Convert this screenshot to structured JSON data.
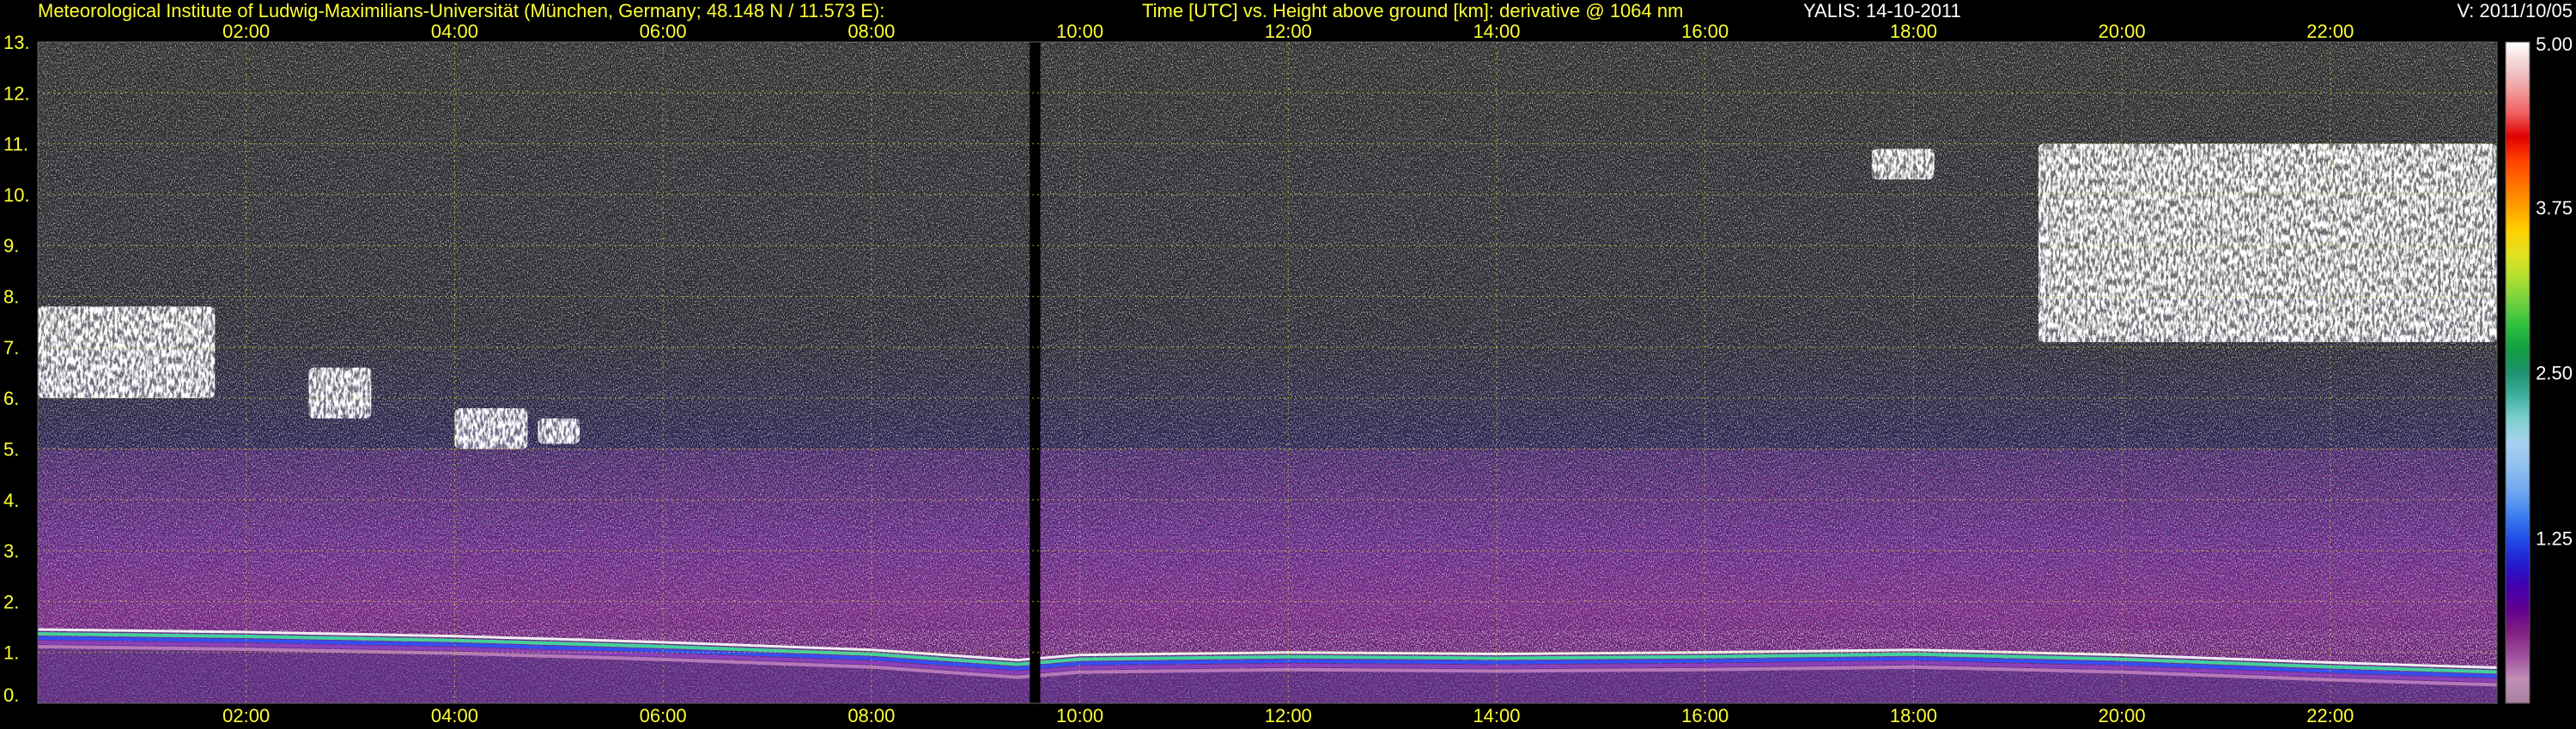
{
  "header": {
    "institute": "Meteorological Institute of Ludwig-Maximilians-Universität (München, Germany; 48.148 N / 11.573 E):",
    "title": "Time [UTC] vs. Height above ground [km]: derivative @ 1064 nm",
    "instrument": "YALIS: 14-10-2011",
    "version": "V: 2011/10/05"
  },
  "colors": {
    "label_yellow": "#ffff33",
    "grid_yellow": "#cccc22",
    "background": "#000000",
    "noise": "#d8d8d8",
    "cloud": "#ffffff"
  },
  "chart_data": {
    "type": "heatmap",
    "title": "Time [UTC] vs. Height above ground [km]: derivative @ 1064 nm",
    "x_unit": "UTC hours",
    "xlim": [
      0,
      23.6
    ],
    "ylim": [
      0,
      13
    ],
    "x_ticks": [
      2,
      4,
      6,
      8,
      10,
      12,
      14,
      16,
      18,
      20,
      22
    ],
    "x_tick_labels": [
      "02:00",
      "04:00",
      "06:00",
      "08:00",
      "10:00",
      "12:00",
      "14:00",
      "16:00",
      "18:00",
      "20:00",
      "22:00"
    ],
    "y_ticks": [
      0,
      1,
      2,
      3,
      4,
      5,
      6,
      7,
      8,
      9,
      10,
      11,
      12,
      13
    ],
    "y_tick_labels": [
      "0.",
      "1.",
      "2.",
      "3.",
      "4.",
      "5.",
      "6.",
      "7.",
      "8.",
      "9.",
      "10.",
      "11.",
      "12.",
      "13."
    ],
    "grid": true,
    "colorbar": {
      "position": "right",
      "min": 0,
      "max": 5,
      "tick_values": [
        1.25,
        2.5,
        3.75,
        5.0
      ],
      "tick_labels": [
        "1.25",
        "2.50",
        "3.75",
        "5.00"
      ],
      "colors": [
        "#a880a0",
        "#c090b8",
        "#a050a0",
        "#802080",
        "#600090",
        "#4000b0",
        "#2020d0",
        "#2050e8",
        "#4080f0",
        "#70a8f0",
        "#90c0f0",
        "#a8d0f0",
        "#80d0d0",
        "#40b0a0",
        "#209070",
        "#10a040",
        "#30c040",
        "#70d040",
        "#b0e030",
        "#e0e020",
        "#ffd000",
        "#ffa000",
        "#ff7000",
        "#ff4000",
        "#e00000",
        "#f06060",
        "#f0a0a0",
        "#f0d0d0",
        "#ffffff"
      ]
    },
    "features": {
      "boundary_layer_top_km": [
        {
          "x": 0.0,
          "y": 1.45
        },
        {
          "x": 2.0,
          "y": 1.4
        },
        {
          "x": 4.0,
          "y": 1.32
        },
        {
          "x": 6.0,
          "y": 1.2
        },
        {
          "x": 8.0,
          "y": 1.05
        },
        {
          "x": 9.4,
          "y": 0.85
        },
        {
          "x": 10.0,
          "y": 0.95
        },
        {
          "x": 12.0,
          "y": 1.0
        },
        {
          "x": 14.0,
          "y": 0.97
        },
        {
          "x": 16.0,
          "y": 1.0
        },
        {
          "x": 18.0,
          "y": 1.05
        },
        {
          "x": 20.0,
          "y": 0.95
        },
        {
          "x": 22.0,
          "y": 0.8
        },
        {
          "x": 23.6,
          "y": 0.7
        }
      ],
      "data_gap_hours": [
        9.52,
        9.62
      ],
      "cloud_layers": [
        {
          "x_start": 0.0,
          "x_end": 1.7,
          "y_bottom": 6.0,
          "y_top": 7.8
        },
        {
          "x_start": 2.6,
          "x_end": 3.2,
          "y_bottom": 5.6,
          "y_top": 6.6
        },
        {
          "x_start": 4.0,
          "x_end": 4.7,
          "y_bottom": 5.0,
          "y_top": 5.8
        },
        {
          "x_start": 4.8,
          "x_end": 5.2,
          "y_bottom": 5.1,
          "y_top": 5.6
        },
        {
          "x_start": 17.6,
          "x_end": 18.2,
          "y_bottom": 10.3,
          "y_top": 10.9
        },
        {
          "x_start": 19.2,
          "x_end": 23.6,
          "y_bottom": 7.1,
          "y_top": 11.0
        }
      ]
    }
  }
}
